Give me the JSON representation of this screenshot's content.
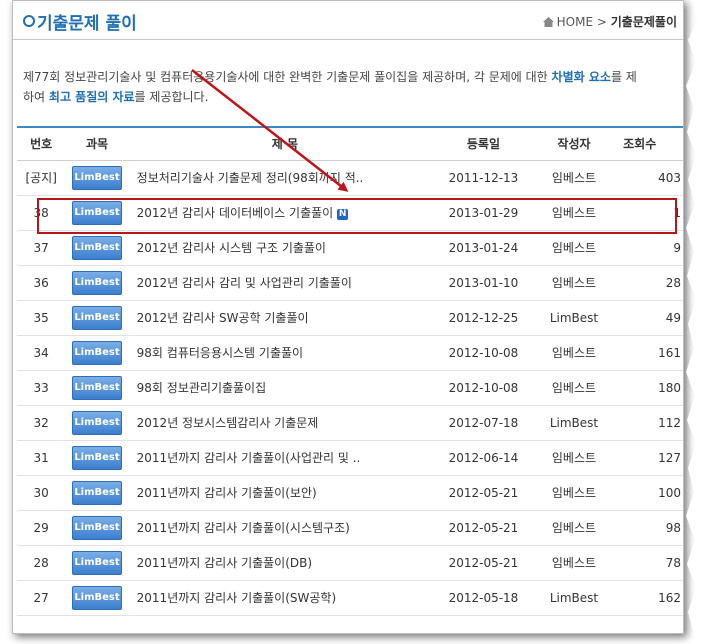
{
  "header": {
    "title": "기출문제 풀이",
    "breadcrumb_home": "HOME",
    "breadcrumb_sep": ">",
    "breadcrumb_current": "기출문제풀이"
  },
  "intro": {
    "line1_a": "제77회 정보관리기술사 및 컴퓨터응용기술사에 대한 완벽한 기출문제 풀이집을 제공하며, 각 문제에 대한 ",
    "line1_hl": "차별화 요소",
    "line1_b": "를 제",
    "line2_a": "하여 ",
    "line2_hl": "최고 품질의 자료",
    "line2_b": "를 제공합니다."
  },
  "table": {
    "headers": {
      "no": "번호",
      "subject": "과목",
      "title": "제 목",
      "date": "등록일",
      "author": "작성자",
      "views": "조회수"
    },
    "badge": "LimBest",
    "new_mark": "N",
    "rows": [
      {
        "no": "[공지]",
        "title": "정보처리기술사 기출문제 정리(98회까지 적..",
        "date": "2011-12-13",
        "author": "임베스트",
        "views": "403"
      },
      {
        "no": "38",
        "title": "2012년 감리사 데이터베이스 기출풀이",
        "date": "2013-01-29",
        "author": "임베스트",
        "views": "1"
      },
      {
        "no": "37",
        "title": "2012년 감리사 시스템 구조 기출풀이",
        "date": "2013-01-24",
        "author": "임베스트",
        "views": "9"
      },
      {
        "no": "36",
        "title": "2012년 감리사 감리 및 사업관리 기출풀이",
        "date": "2013-01-10",
        "author": "임베스트",
        "views": "28"
      },
      {
        "no": "35",
        "title": "2012년 감리사 SW공학 기출풀이",
        "date": "2012-12-25",
        "author": "LimBest",
        "views": "49"
      },
      {
        "no": "34",
        "title": "98회 컴퓨터응용시스템 기출풀이",
        "date": "2012-10-08",
        "author": "임베스트",
        "views": "161"
      },
      {
        "no": "33",
        "title": "98회 정보관리기출풀이집",
        "date": "2012-10-08",
        "author": "임베스트",
        "views": "180"
      },
      {
        "no": "32",
        "title": "2012년 정보시스템감리사 기출문제",
        "date": "2012-07-18",
        "author": "LimBest",
        "views": "112"
      },
      {
        "no": "31",
        "title": "2011년까지 감리사 기출풀이(사업관리 및 ..",
        "date": "2012-06-14",
        "author": "임베스트",
        "views": "127"
      },
      {
        "no": "30",
        "title": "2011년까지 감리사 기출풀이(보안)",
        "date": "2012-05-21",
        "author": "임베스트",
        "views": "100"
      },
      {
        "no": "29",
        "title": "2011년까지 감리사 기출풀이(시스템구조)",
        "date": "2012-05-21",
        "author": "임베스트",
        "views": "98"
      },
      {
        "no": "28",
        "title": "2011년까지 감리사 기출풀이(DB)",
        "date": "2012-05-21",
        "author": "임베스트",
        "views": "78"
      },
      {
        "no": "27",
        "title": "2011년까지 감리사 기출풀이(SW공학)",
        "date": "2012-05-18",
        "author": "LimBest",
        "views": "162"
      }
    ]
  },
  "colors": {
    "accent": "#1f6fb5",
    "highlight_box": "#b8141a",
    "arrow": "#c0141a"
  }
}
